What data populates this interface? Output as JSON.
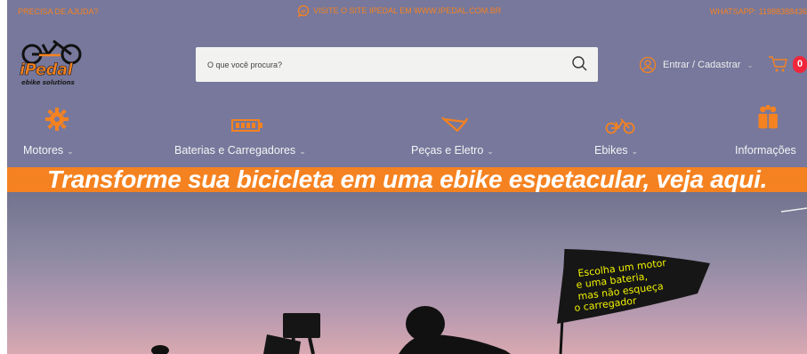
{
  "topbar": {
    "help": "PRECISA DE AJUDA?",
    "site": "VISITE O SITE IPEDAL EM WWW.IPEDAL.COM.BR",
    "whatsapp": "WHATSAPP: 11988388436"
  },
  "logo": {
    "wordmark": "iPedal",
    "tagline": "ebike solutions"
  },
  "search": {
    "placeholder": "O que você procura?"
  },
  "account": {
    "label": "Entrar / Cadastrar"
  },
  "cart": {
    "count": "0"
  },
  "nav": {
    "items": [
      {
        "label": "Motores",
        "icon": "motor-icon"
      },
      {
        "label": "Baterias e Carregadores",
        "icon": "battery-icon"
      },
      {
        "label": "Peças e Eletro",
        "icon": "bike-frame-icon"
      },
      {
        "label": "Ebikes",
        "icon": "bicycle-icon"
      },
      {
        "label": "Informações",
        "icon": "info-people-icon"
      }
    ]
  },
  "banner": {
    "text": "Transforme sua bicicleta em uma ebike espetacular, veja aqui."
  },
  "hero": {
    "flag_lines": [
      "Escolha um motor",
      "e uma bateria,",
      "mas não esqueça",
      "o carregador"
    ]
  },
  "colors": {
    "accent": "#f58220",
    "header_bg": "#77789c",
    "badge": "#f0263b"
  }
}
